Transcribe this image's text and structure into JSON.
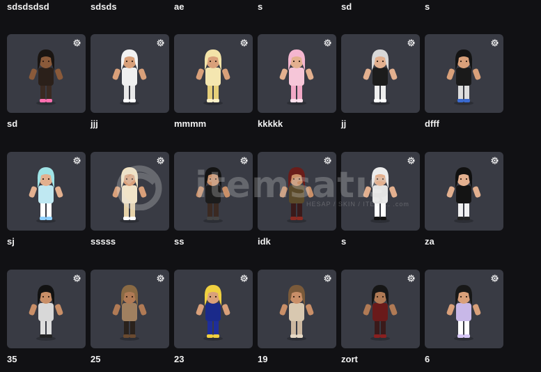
{
  "top_names": [
    "sdsdsdsd",
    "sdsds",
    "ae",
    "s",
    "sd",
    "s"
  ],
  "rows": [
    {
      "names": [
        "sd",
        "jjj",
        "mmmm",
        "kkkkk",
        "jj",
        "dfff"
      ]
    },
    {
      "names": [
        "sj",
        "sssss",
        "ss",
        "idk",
        "s",
        "za"
      ]
    },
    {
      "names": [
        "35",
        "25",
        "23",
        "19",
        "zort",
        "6"
      ]
    }
  ],
  "outfits": [
    [
      {
        "hair": "#1a1512",
        "top": "#2b201a",
        "bottom": "#3a2a22",
        "skin": "#8a5a3a",
        "accent": "#ff6fb0"
      },
      {
        "hair": "#f2f2f2",
        "top": "#f0f0f0",
        "bottom": "#e8e8e8",
        "skin": "#d9a07a",
        "accent": "#ffffff"
      },
      {
        "hair": "#f3e3a8",
        "top": "#f4e6b0",
        "bottom": "#e6cf7a",
        "skin": "#d9a07a",
        "accent": "#fff2c8"
      },
      {
        "hair": "#f4b6cf",
        "top": "#f6c6d8",
        "bottom": "#f2a8c6",
        "skin": "#e3b08f",
        "accent": "#ffe0ec"
      },
      {
        "hair": "#d8d8d8",
        "top": "#1c1c1c",
        "bottom": "#eeeeee",
        "skin": "#e3b08f",
        "accent": "#ffffff"
      },
      {
        "hair": "#141414",
        "top": "#1a1a1a",
        "bottom": "#dddddd",
        "skin": "#d9a07a",
        "accent": "#3a6ad0"
      }
    ],
    [
      {
        "hair": "#9fe3e6",
        "top": "#bfe8f2",
        "bottom": "#ffffff",
        "skin": "#e3b08f",
        "accent": "#8fd0ff"
      },
      {
        "hair": "#f3e3c0",
        "top": "#f1e4c8",
        "bottom": "#e6d2a8",
        "skin": "#d9a07a",
        "accent": "#ffffff"
      },
      {
        "hair": "#141414",
        "top": "#1c1c1c",
        "bottom": "#3b2a22",
        "skin": "#c98f68",
        "accent": "#444444"
      },
      {
        "hair": "#6a1d1a",
        "top": "#5a4a2a",
        "bottom": "#3a1a1a",
        "skin": "#c98f68",
        "accent": "#8a2a22"
      },
      {
        "hair": "#ececec",
        "top": "#e9e9e9",
        "bottom": "#ffffff",
        "skin": "#e3b08f",
        "accent": "#111111"
      },
      {
        "hair": "#111111",
        "top": "#141414",
        "bottom": "#f0f0f0",
        "skin": "#e3b08f",
        "accent": "#222222"
      }
    ],
    [
      {
        "hair": "#121212",
        "top": "#d8d8d8",
        "bottom": "#dedede",
        "skin": "#c98f68",
        "accent": "#222222"
      },
      {
        "hair": "#8a6a44",
        "top": "#a08060",
        "bottom": "#2a221c",
        "skin": "#b07a55",
        "accent": "#6a4a30"
      },
      {
        "hair": "#f0d040",
        "top": "#1a2a8a",
        "bottom": "#1e2e9a",
        "skin": "#d9a07a",
        "accent": "#f0d040"
      },
      {
        "hair": "#7a5a3a",
        "top": "#d8c8b0",
        "bottom": "#cdb8a0",
        "skin": "#c98f68",
        "accent": "#e6d8c4"
      },
      {
        "hair": "#161616",
        "top": "#6a1a1a",
        "bottom": "#3a1a1a",
        "skin": "#b07a55",
        "accent": "#8a2020"
      },
      {
        "hair": "#181818",
        "top": "#c8b8e8",
        "bottom": "#ffffff",
        "skin": "#d9a07a",
        "accent": "#d6c6f6"
      }
    ]
  ],
  "watermark": {
    "text": "itemsatış",
    "sub": "HESAP / SKIN / ITEM ... .com"
  }
}
